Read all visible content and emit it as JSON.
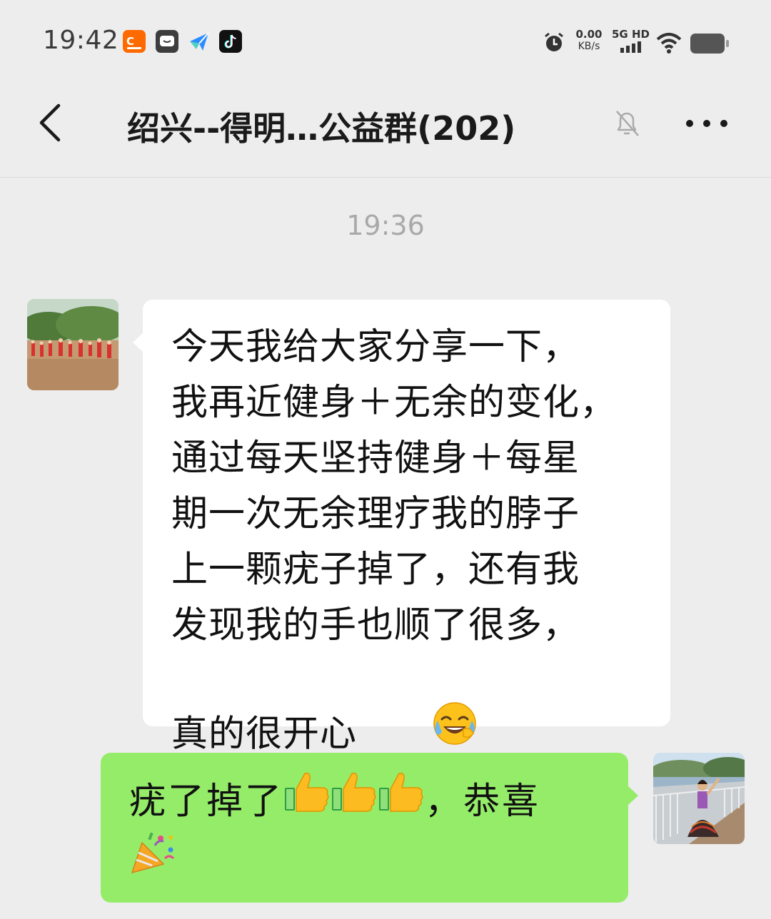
{
  "status_bar": {
    "time": "19:42",
    "app_icons": [
      "app-1688-icon",
      "chat-app-icon",
      "paper-plane-icon",
      "tiktok-icon"
    ],
    "net_speed_value": "0.00",
    "net_speed_unit": "KB/s",
    "network_type": "5G HD",
    "icons": [
      "alarm-icon",
      "signal-icon",
      "wifi-icon",
      "battery-icon"
    ]
  },
  "header": {
    "title": "绍兴--得明…公益群(202)",
    "icons": [
      "back-icon",
      "mute-bell-icon",
      "more-icon"
    ]
  },
  "chat": {
    "timestamp": "19:36",
    "messages": [
      {
        "direction": "incoming",
        "text": "今天我给大家分享一下，\n我再近健身＋无余的变化，\n通过每天坚持健身＋每星\n期一次无余理疗我的脖子\n上一颗疣子掉了，还有我\n发现我的手也顺了很多，\n真的很开心",
        "trailing_emoji": "laughing-crying-face-emoji"
      },
      {
        "direction": "outgoing",
        "text": "疣了掉了",
        "emojis": [
          "thumbs-up-emoji",
          "thumbs-up-emoji",
          "thumbs-up-emoji"
        ],
        "text_after": "，恭喜",
        "trailing_emoji": "party-popper-emoji"
      }
    ]
  },
  "colors": {
    "background": "#ededed",
    "incoming_bubble": "#ffffff",
    "outgoing_bubble": "#95ec69",
    "timestamp_text": "#a9a9a9"
  }
}
